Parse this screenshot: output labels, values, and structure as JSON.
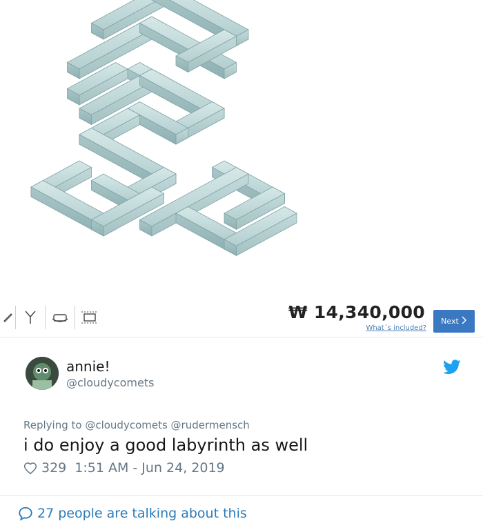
{
  "product": {
    "price": "₩ 14,340,000",
    "included_link": "What´s included?",
    "next_label": "Next",
    "toolbar_icons": [
      "ruler-icon",
      "fork-icon",
      "sofa-rotate-icon",
      "dimensions-icon"
    ],
    "sofa_color": "#b9d4d4"
  },
  "tweet": {
    "display_name": "annie!",
    "handle": "@cloudycomets",
    "reply_to": "Replying to @cloudycomets @rudermensch",
    "text": "i do enjoy a good labyrinth as well",
    "likes": "329",
    "timestamp": "1:51 AM - Jun 24, 2019",
    "talking": "27 people are talking about this"
  },
  "colors": {
    "twitter_blue": "#1da1f2",
    "link_blue": "#2b7bb9",
    "next_button": "#3b78c2"
  }
}
